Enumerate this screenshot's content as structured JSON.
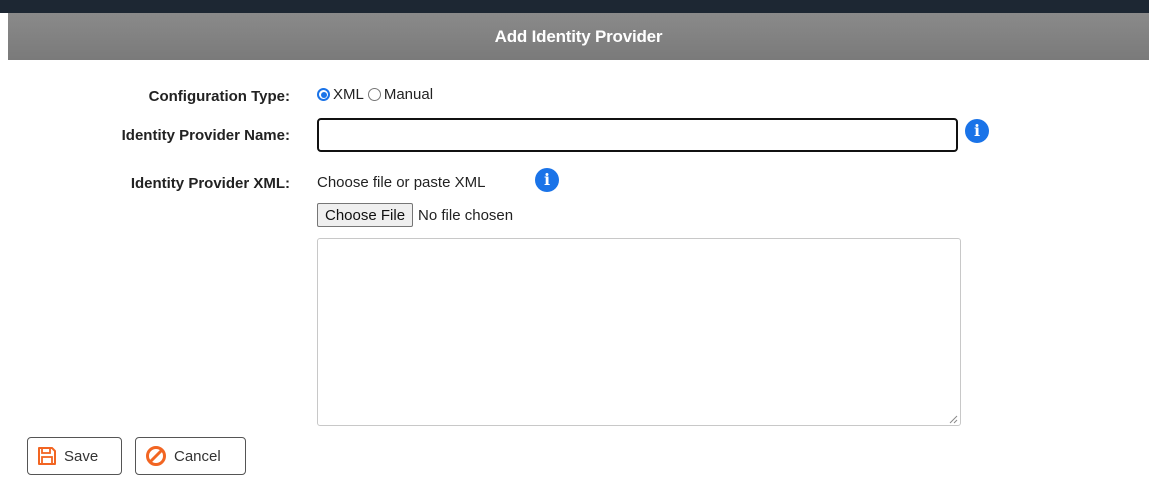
{
  "dialog": {
    "title": "Add Identity Provider"
  },
  "form": {
    "config_type": {
      "label": "Configuration Type:",
      "options": [
        {
          "label": "XML",
          "selected": true
        },
        {
          "label": "Manual",
          "selected": false
        }
      ]
    },
    "provider_name": {
      "label": "Identity Provider Name:",
      "value": "",
      "placeholder": ""
    },
    "provider_xml": {
      "label": "Identity Provider XML:",
      "hint": "Choose file or paste XML",
      "file_button": "Choose File",
      "file_status": "No file chosen",
      "value": ""
    }
  },
  "actions": {
    "save_label": "Save",
    "cancel_label": "Cancel"
  },
  "icons": {
    "info": "info-icon",
    "save": "floppy-disk-icon",
    "cancel": "prohibited-icon"
  },
  "colors": {
    "header": "#808080",
    "accent": "#1a73e8",
    "cancel_icon": "#f26522",
    "save_icon": "#f26522"
  }
}
